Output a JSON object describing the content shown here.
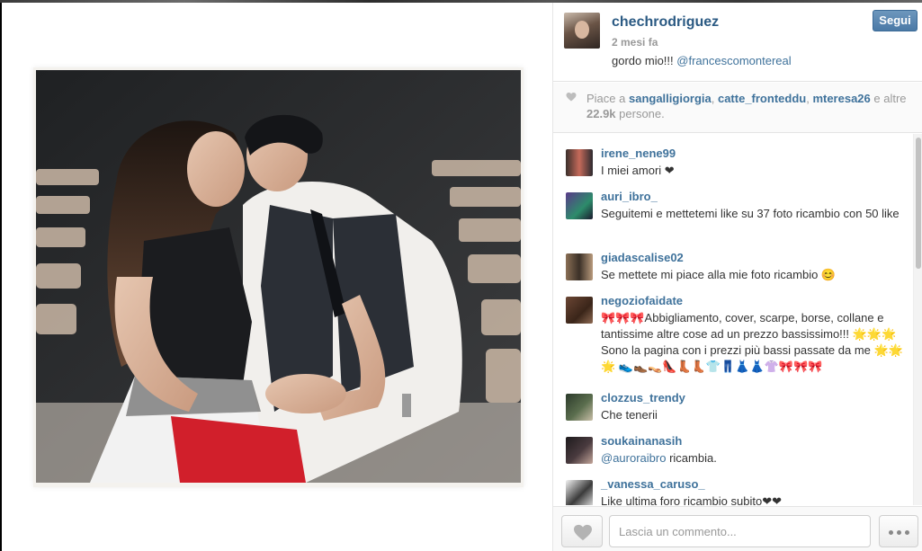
{
  "post": {
    "username": "chechrodriguez",
    "time_ago": "2 mesi fa",
    "caption_text": "gordo mio!!! ",
    "caption_mention": "@francescomontereal",
    "follow_label": "Segui"
  },
  "likes": {
    "prefix": "Piace a ",
    "users": [
      "sangalligiorgia",
      "catte_fronteddu",
      "mteresa26"
    ],
    "sep": ", ",
    "and_text": " e altre ",
    "count": "22.9k",
    "suffix": " persone."
  },
  "comments": [
    {
      "user": "irene_nene99",
      "text": "I miei amori ❤"
    },
    {
      "user": "auri_ibro_",
      "text": "Seguitemi e mettetemi like su 37 foto ricambio con 50 like"
    },
    {
      "user": "giadascalise02",
      "text": "Se mettete mi piace alla mie foto ricambio 😊"
    },
    {
      "user": "negoziofaidate",
      "text": "🎀🎀🎀Abbigliamento, cover, scarpe, borse, collane e tantissime altre cose ad un prezzo bassissimo!!! 🌟🌟🌟Sono la pagina con i prezzi più bassi passate da me 🌟🌟🌟 👟👞👡👠👢👢👕👖👗👗👚🎀🎀🎀"
    },
    {
      "user": "clozzus_trendy",
      "text": "Che tenerii"
    },
    {
      "user": "soukainanasih",
      "mention": "@auroraibro",
      "text": " ricambia."
    },
    {
      "user": "_vanessa_caruso_",
      "text": "Like ultima foro ricambio subito❤❤"
    }
  ],
  "footer": {
    "comment_placeholder": "Lascia un commento..."
  },
  "icons": {
    "like": "heart-icon",
    "more": "ellipsis-icon"
  },
  "colors": {
    "link": "#3f729b",
    "username": "#2b5a83",
    "follow_button": "#4b79a6"
  }
}
